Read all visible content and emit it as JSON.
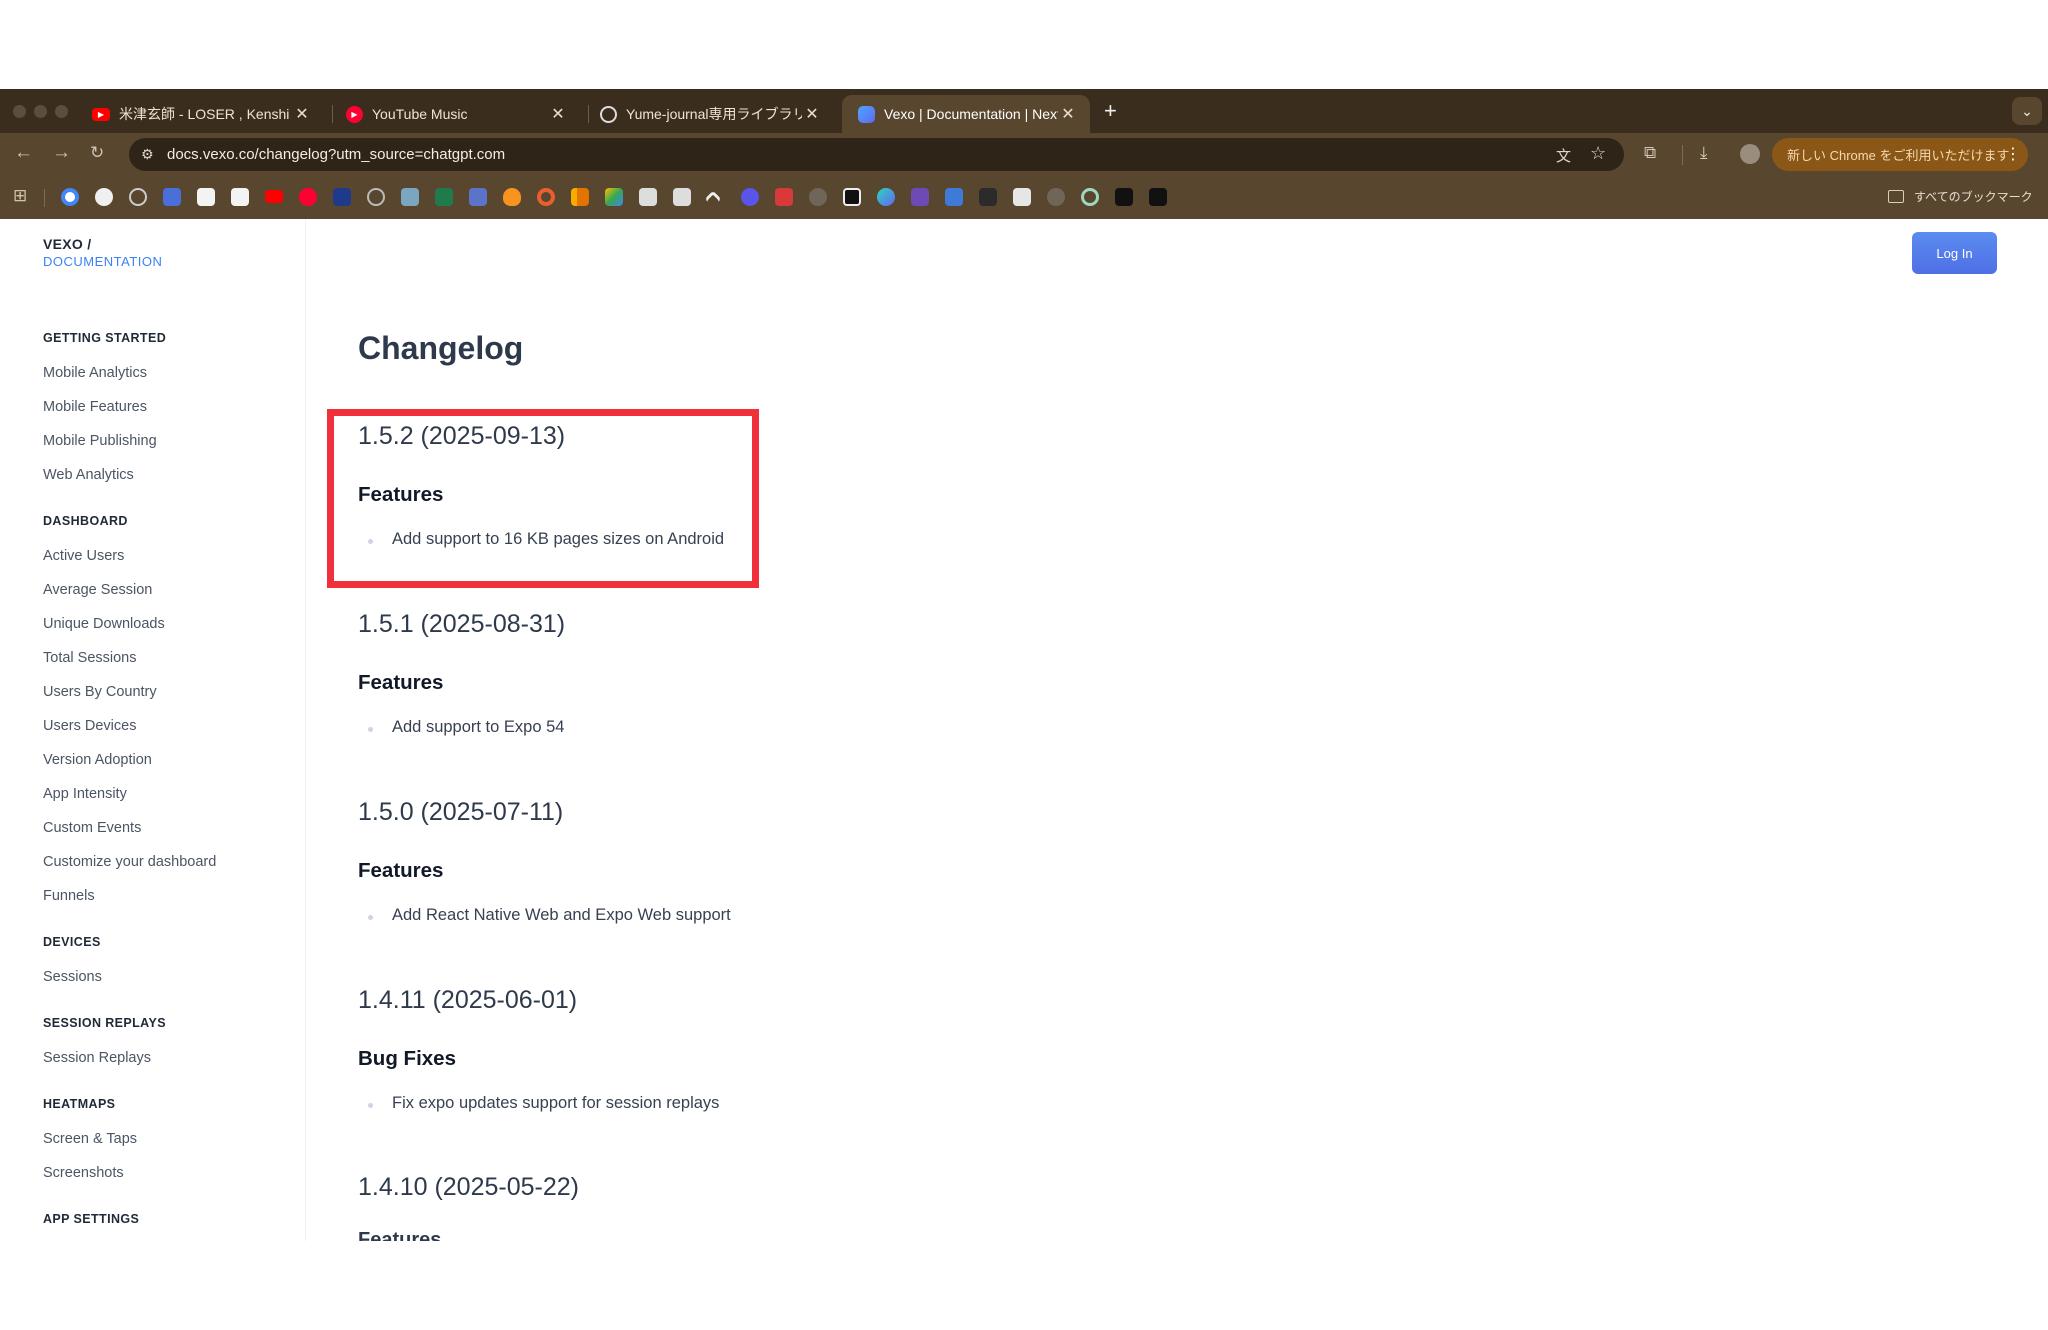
{
  "browser": {
    "tabs": [
      {
        "title": "米津玄師 - LOSER , Kenshi Yon",
        "close": "✕"
      },
      {
        "title": "YouTube Music",
        "close": "✕"
      },
      {
        "title": "Yume-journal専用ライブラリ",
        "close": "✕"
      },
      {
        "title": "Vexo | Documentation | Next",
        "close": "✕",
        "active": true
      }
    ],
    "new_tab": "+",
    "tab_menu": "⌄",
    "url": "docs.vexo.co/changelog?utm_source=chatgpt.com",
    "update_button": "新しい Chrome をご利用いただけます",
    "update_menu": "⋮",
    "all_bookmarks": "すべてのブックマーク",
    "colors": {
      "tab_strip": "#3b2d1e",
      "toolbar": "#58462f",
      "update_button": "#8a5716"
    }
  },
  "sidebar": {
    "brand_top": "VEXO /",
    "brand_bottom": "DOCUMENTATION",
    "sections": [
      {
        "heading": "GETTING STARTED",
        "items": [
          "Mobile Analytics",
          "Mobile Features",
          "Mobile Publishing",
          "Web Analytics"
        ]
      },
      {
        "heading": "DASHBOARD",
        "items": [
          "Active Users",
          "Average Session",
          "Unique Downloads",
          "Total Sessions",
          "Users By Country",
          "Users Devices",
          "Version Adoption",
          "App Intensity",
          "Custom Events",
          "Customize your dashboard",
          "Funnels"
        ]
      },
      {
        "heading": "DEVICES",
        "items": [
          "Sessions"
        ]
      },
      {
        "heading": "SESSION REPLAYS",
        "items": [
          "Session Replays"
        ]
      },
      {
        "heading": "HEATMAPS",
        "items": [
          "Screen & Taps",
          "Screenshots"
        ]
      },
      {
        "heading": "APP SETTINGS",
        "items": []
      }
    ]
  },
  "header": {
    "login": "Log In"
  },
  "content": {
    "title": "Changelog",
    "releases": [
      {
        "version": "1.5.2 (2025-09-13)",
        "section": "Features",
        "items": [
          "Add support to 16 KB pages sizes on Android"
        ]
      },
      {
        "version": "1.5.1 (2025-08-31)",
        "section": "Features",
        "items": [
          "Add support to Expo 54"
        ]
      },
      {
        "version": "1.5.0 (2025-07-11)",
        "section": "Features",
        "items": [
          "Add React Native Web and Expo Web support"
        ]
      },
      {
        "version": "1.4.11 (2025-06-01)",
        "section": "Bug Fixes",
        "items": [
          "Fix expo updates support for session replays"
        ]
      },
      {
        "version": "1.4.10 (2025-05-22)",
        "section": "Features",
        "items": []
      }
    ],
    "highlight_color": "#f0313b"
  }
}
